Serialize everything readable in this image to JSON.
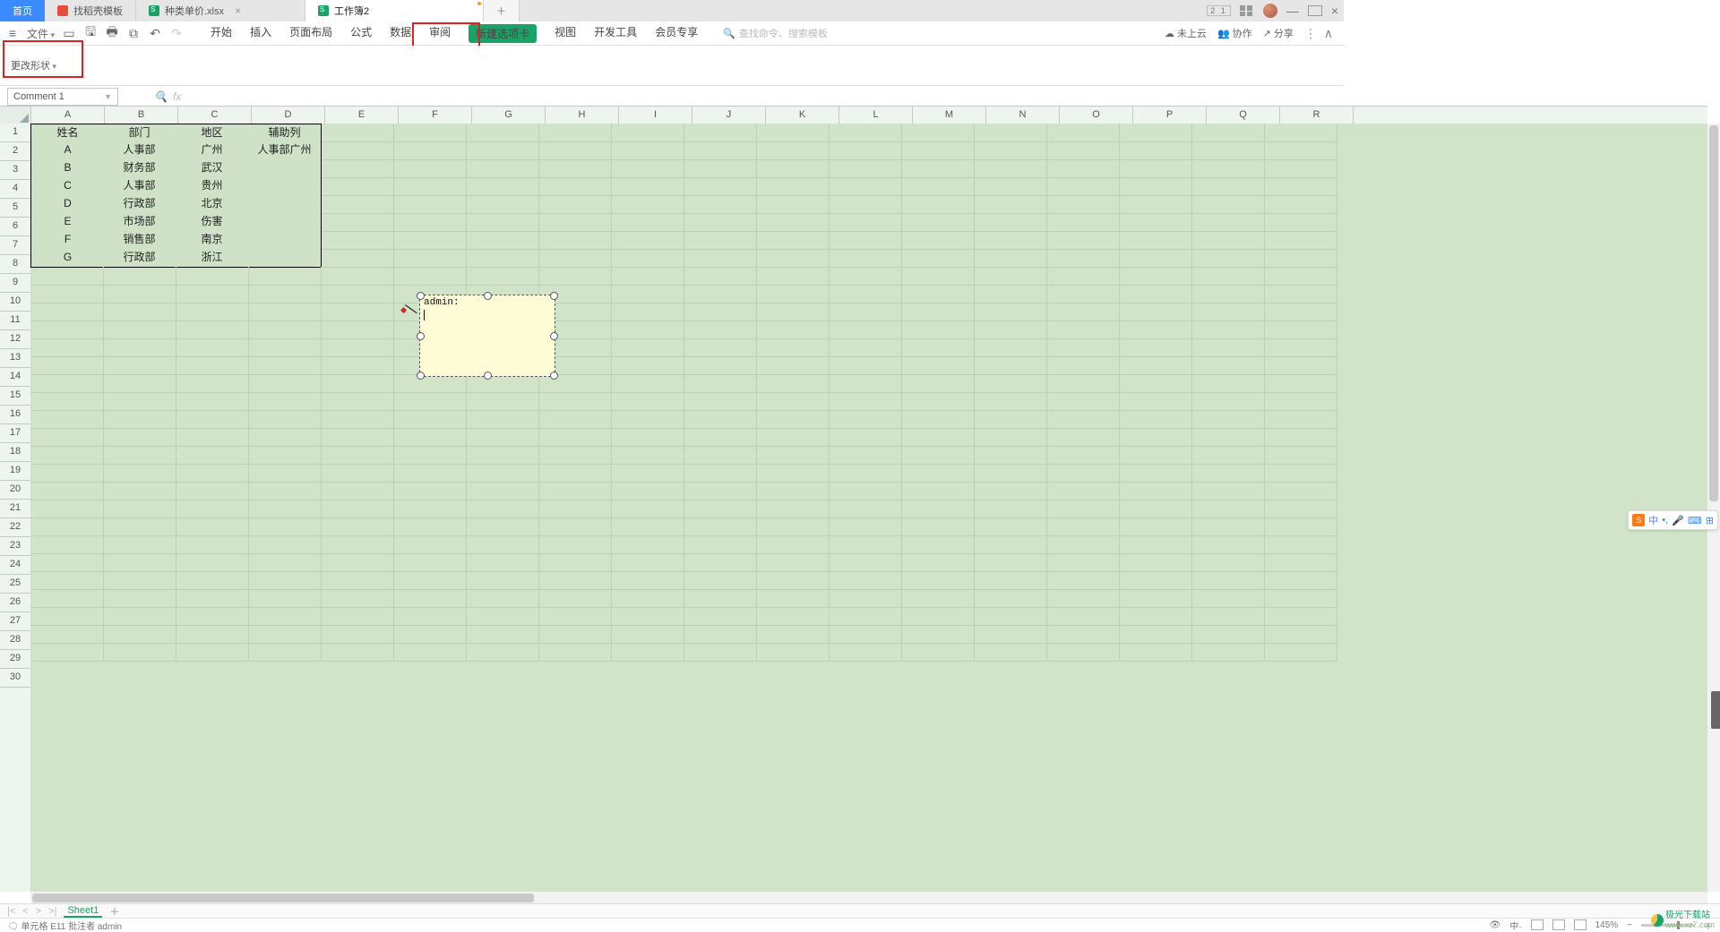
{
  "tabs": {
    "home": "首页",
    "t1": "找稻壳模板",
    "t2": "种类单价.xlsx",
    "t3": "工作簿2"
  },
  "win": {
    "count": "2 1"
  },
  "file_label": "文件",
  "menus": [
    "开始",
    "插入",
    "页面布局",
    "公式",
    "数据",
    "审阅",
    "新建选项卡",
    "视图",
    "开发工具",
    "会员专享"
  ],
  "newtab_idx": 6,
  "search_placeholder": "查找命令、搜索模板",
  "right_menu": {
    "cloud": "未上云",
    "coop": "协作",
    "share": "分享"
  },
  "ribbon": {
    "change_shape": "更改形状"
  },
  "namebox": "Comment 1",
  "fx": "fx",
  "columns": [
    "A",
    "B",
    "C",
    "D",
    "E",
    "F",
    "G",
    "H",
    "I",
    "J",
    "K",
    "L",
    "M",
    "N",
    "O",
    "P",
    "Q",
    "R"
  ],
  "row_count": 30,
  "table": {
    "header": [
      "姓名",
      "部门",
      "地区",
      "辅助列"
    ],
    "rows": [
      [
        "A",
        "人事部",
        "广州",
        "人事部广州"
      ],
      [
        "B",
        "财务部",
        "武汉",
        ""
      ],
      [
        "C",
        "人事部",
        "贵州",
        ""
      ],
      [
        "D",
        "行政部",
        "北京",
        ""
      ],
      [
        "E",
        "市场部",
        "伤害",
        ""
      ],
      [
        "F",
        "销售部",
        "南京",
        ""
      ],
      [
        "G",
        "行政部",
        "浙江",
        ""
      ]
    ]
  },
  "comment": {
    "author": "admin:"
  },
  "sheet": {
    "name": "Sheet1"
  },
  "status": {
    "left": "单元格 E11 批注者 admin",
    "zoom": "145%"
  },
  "ime": {
    "lang": "中"
  },
  "watermark": {
    "name": "极光下载站",
    "url": "www.xz7.com"
  }
}
